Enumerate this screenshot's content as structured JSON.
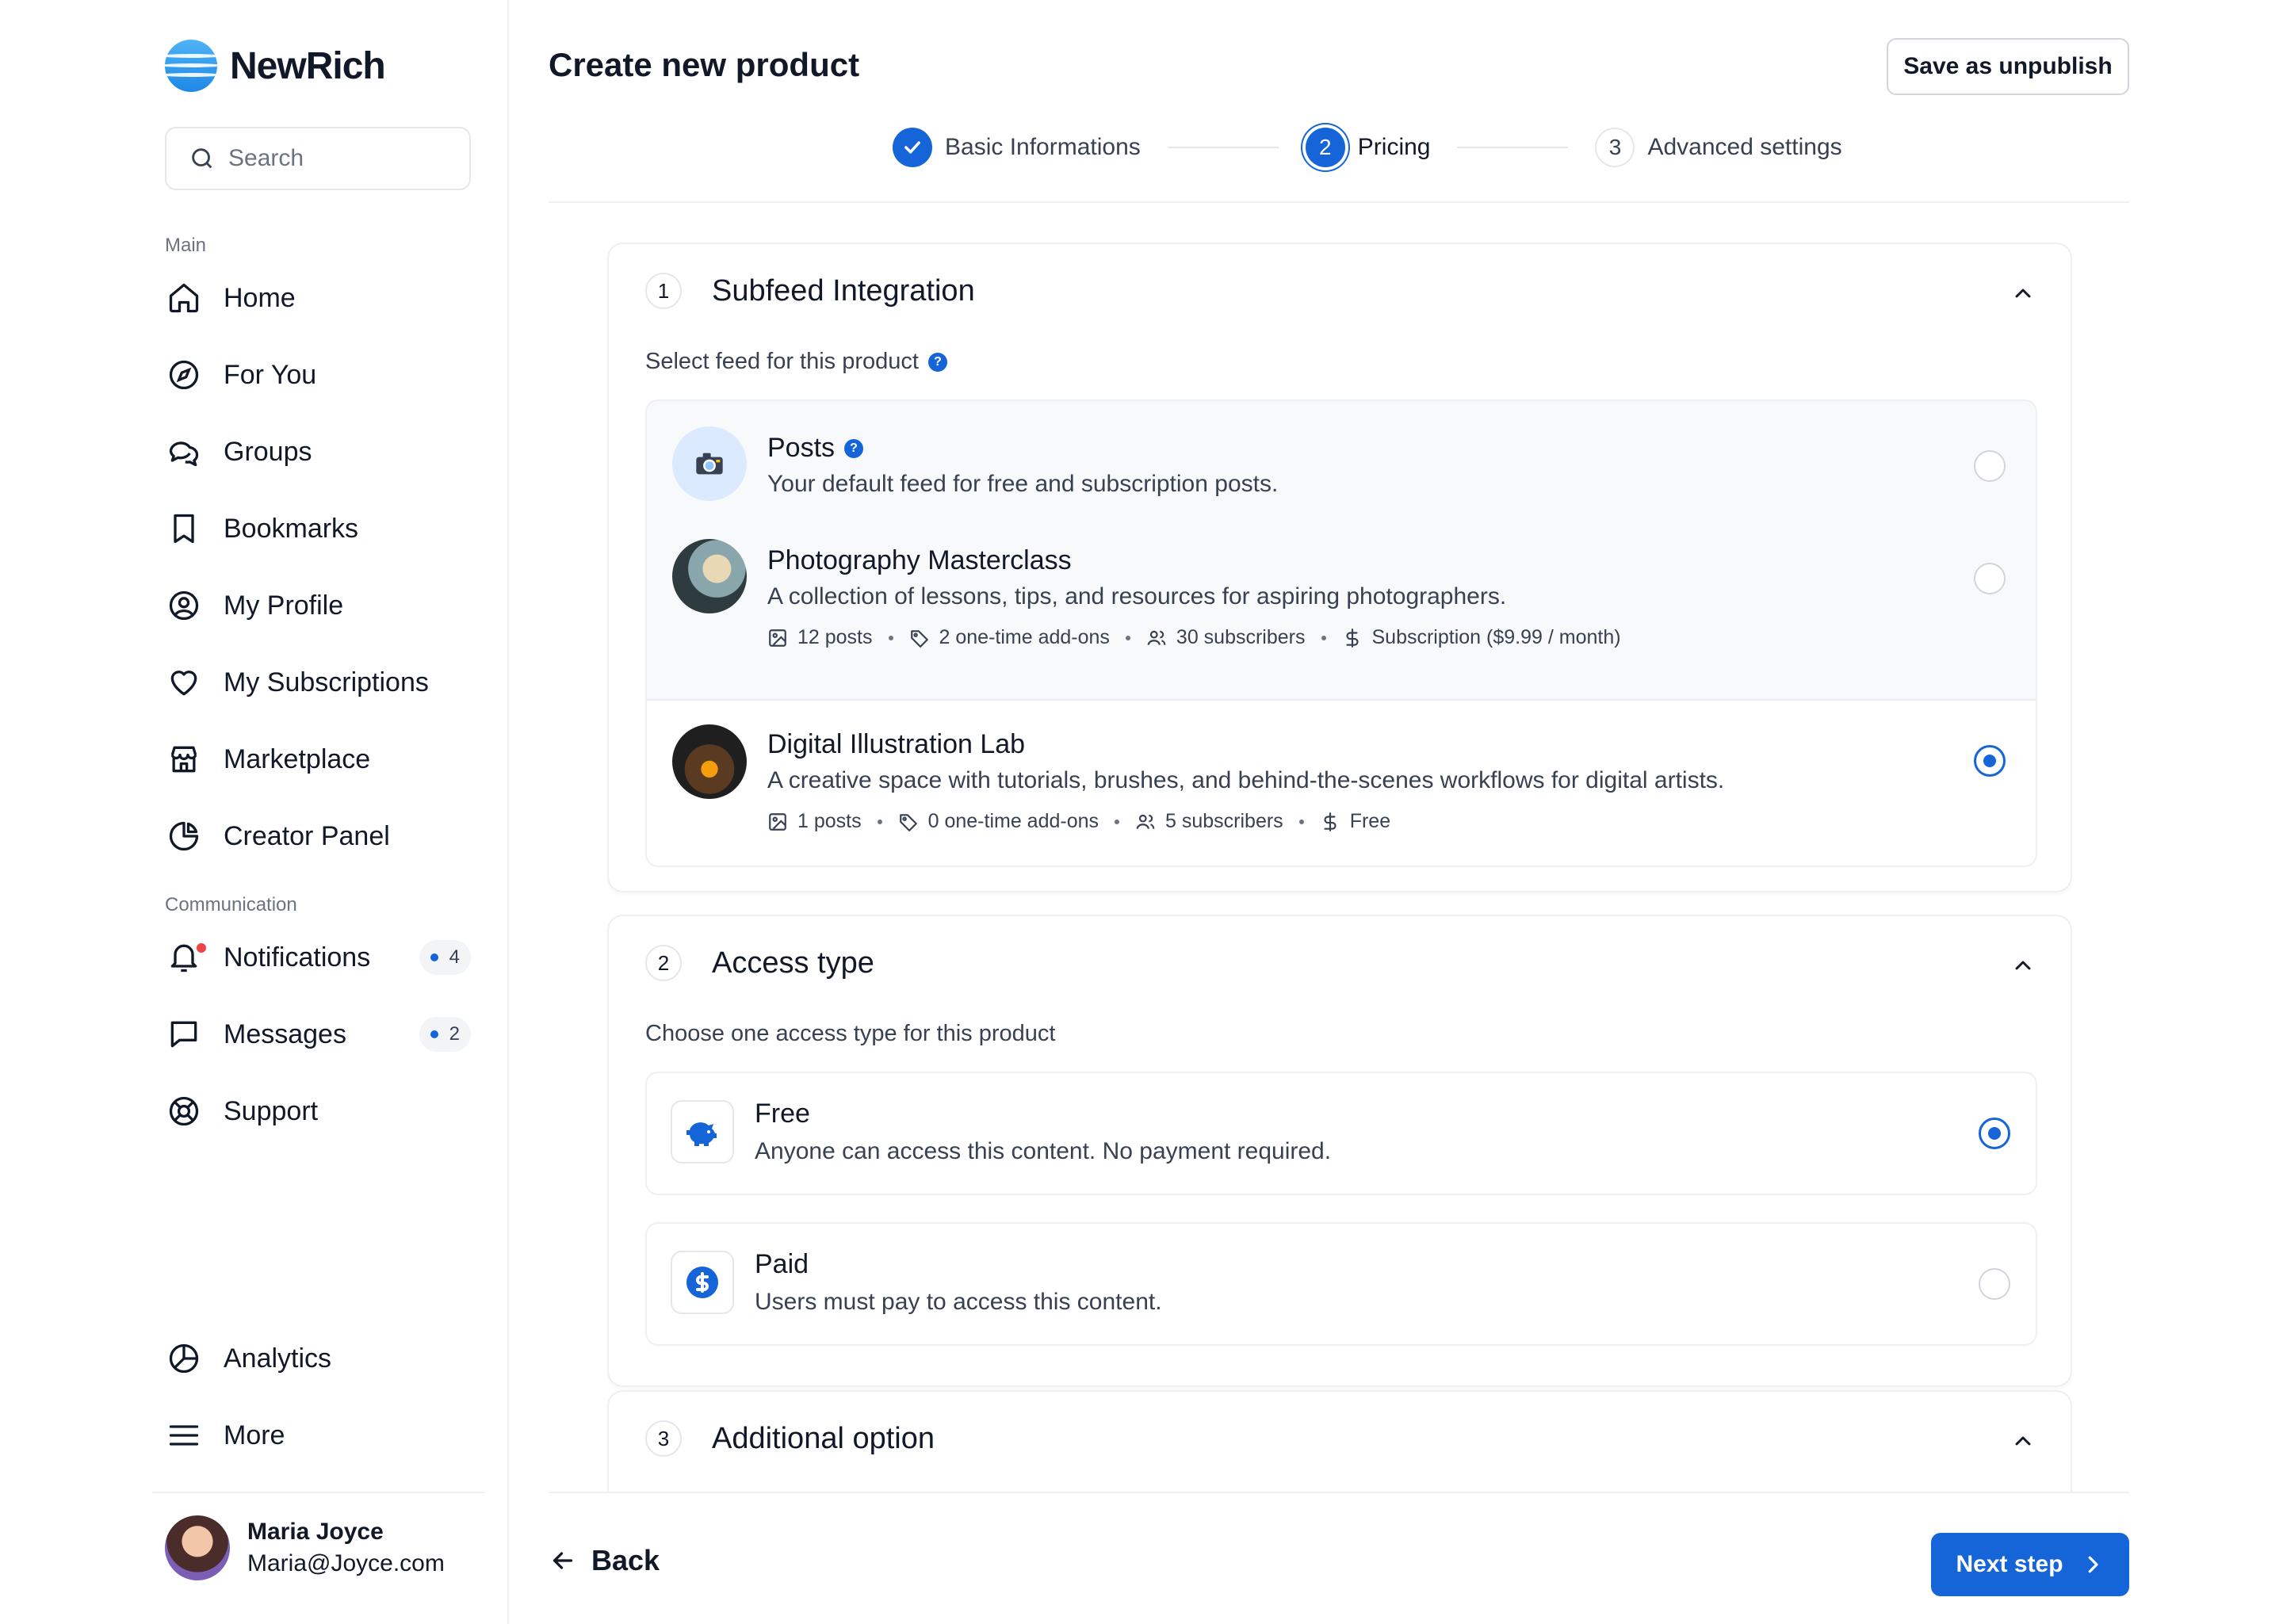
{
  "app": {
    "name": "NewRich"
  },
  "search": {
    "placeholder": "Search"
  },
  "sidebar": {
    "main_label": "Main",
    "main_items": [
      {
        "label": "Home",
        "icon": "home-icon"
      },
      {
        "label": "For You",
        "icon": "compass-icon"
      },
      {
        "label": "Groups",
        "icon": "chat-bubbles-icon"
      },
      {
        "label": "Bookmarks",
        "icon": "bookmark-icon"
      },
      {
        "label": "My Profile",
        "icon": "user-circle-icon"
      },
      {
        "label": "My Subscriptions",
        "icon": "heart-icon"
      },
      {
        "label": "Marketplace",
        "icon": "store-icon"
      },
      {
        "label": "Creator Panel",
        "icon": "pie-chart-icon"
      }
    ],
    "communication_label": "Communication",
    "communication_items": [
      {
        "label": "Notifications",
        "icon": "bell-icon",
        "badge": "4"
      },
      {
        "label": "Messages",
        "icon": "message-icon",
        "badge": "2"
      },
      {
        "label": "Support",
        "icon": "lifebuoy-icon"
      }
    ],
    "bottom_items": [
      {
        "label": "Analytics",
        "icon": "analytics-icon"
      },
      {
        "label": "More",
        "icon": "menu-icon"
      }
    ],
    "user": {
      "name": "Maria Joyce",
      "email": "Maria@Joyce.com"
    }
  },
  "header": {
    "title": "Create new product",
    "save_label": "Save as unpublish",
    "steps": [
      {
        "label": "Basic Informations",
        "state": "done"
      },
      {
        "label": "Pricing",
        "number": "2",
        "state": "active"
      },
      {
        "label": "Advanced settings",
        "number": "3",
        "state": "todo"
      }
    ]
  },
  "sections": {
    "subfeed": {
      "number": "1",
      "title": "Subfeed Integration",
      "subtitle": "Select feed for this product",
      "feeds": [
        {
          "title": "Posts",
          "description": "Your default feed for free and subscription posts.",
          "selected": false
        },
        {
          "title": "Photography Masterclass",
          "description": "A collection of lessons, tips, and resources for aspiring photographers.",
          "posts": "12 posts",
          "addons": "2 one-time add-ons",
          "subscribers": "30 subscribers",
          "price": "Subscription ($9.99 / month)",
          "selected": false
        },
        {
          "title": "Digital Illustration Lab",
          "description": "A creative space with tutorials, brushes, and behind-the-scenes workflows for digital artists.",
          "posts": "1 posts",
          "addons": "0 one-time add-ons",
          "subscribers": "5 subscribers",
          "price": "Free",
          "selected": true
        }
      ]
    },
    "access": {
      "number": "2",
      "title": "Access type",
      "subtitle": "Choose one access type for this product",
      "options": [
        {
          "title": "Free",
          "description": "Anyone can access this content. No payment required.",
          "selected": true
        },
        {
          "title": "Paid",
          "description": "Users must pay to access this content.",
          "selected": false
        }
      ]
    },
    "additional": {
      "number": "3",
      "title": "Additional option"
    }
  },
  "footer": {
    "back_label": "Back",
    "next_label": "Next step"
  },
  "colors": {
    "accent": "#1565d8",
    "border": "#eef0f3",
    "text": "#111827",
    "muted": "#374151"
  }
}
